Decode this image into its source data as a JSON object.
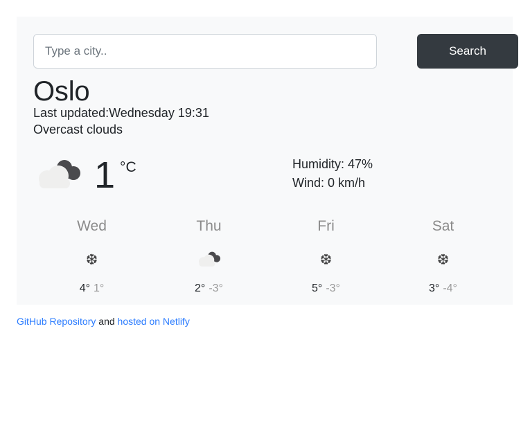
{
  "search": {
    "placeholder": "Type a city..",
    "value": "",
    "button_label": "Search"
  },
  "current": {
    "city": "Oslo",
    "last_updated": "Last updated:Wednesday 19:31",
    "condition": "Overcast clouds",
    "icon": "broken-clouds-icon",
    "temperature": "1",
    "unit": "°C",
    "humidity": "Humidity: 47%",
    "wind": "Wind: 0 km/h"
  },
  "forecast": [
    {
      "day": "Wed",
      "icon": "snowflake-icon",
      "high": "4°",
      "low": "1°"
    },
    {
      "day": "Thu",
      "icon": "broken-clouds-icon",
      "high": "2°",
      "low": "-3°"
    },
    {
      "day": "Fri",
      "icon": "snowflake-icon",
      "high": "5°",
      "low": "-3°"
    },
    {
      "day": "Sat",
      "icon": "snowflake-icon",
      "high": "3°",
      "low": "-4°"
    }
  ],
  "footer": {
    "repo_link": "GitHub Repository",
    "separator": " and ",
    "host_link": "hosted on Netlify"
  },
  "colors": {
    "page_background": "#ffffff",
    "card_background": "#f8f9fa",
    "button_background": "#343a40",
    "link": "#2b7cff",
    "muted_text": "#8b8b8b",
    "dark_cloud": "#4a4a4d",
    "light_cloud": "#efefee"
  },
  "icons": {
    "snowflake_glyph": "❆"
  }
}
